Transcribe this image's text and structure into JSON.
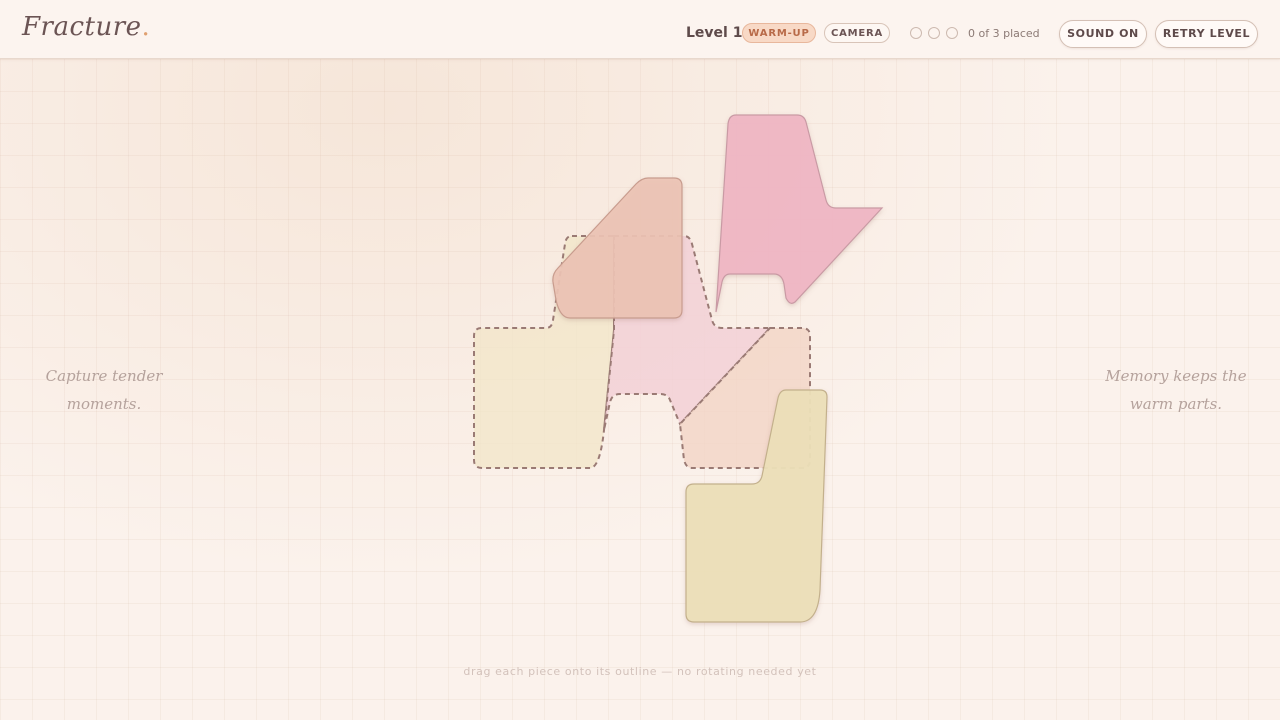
{
  "header": {
    "logo": "Fracture",
    "logo_dot": ".",
    "level": "Level 1",
    "mode_badge": "WARM-UP",
    "camera_label": "CAMERA",
    "progress": {
      "placed": 0,
      "total": 3
    },
    "progress_text": "0 of 3 placed",
    "sound_button": "SOUND ON",
    "retry_button": "RETRY LEVEL"
  },
  "quotes": {
    "left_line1": "Capture tender",
    "left_line2": "moments.",
    "right_line1": "Memory keeps the",
    "right_line2": "warm parts."
  },
  "hint": "drag each piece onto its outline — no rotating needed yet",
  "colors": {
    "outline_stroke": "#9a7a74",
    "piece_cream": "#ecdfb8",
    "piece_pink": "#efb6c4",
    "piece_peach": "#ecc3b4",
    "accent": "#e0a070"
  },
  "pieces": [
    {
      "name": "cream-piece",
      "color": "#ecdfb8"
    },
    {
      "name": "pink-piece",
      "color": "#efb6c4"
    },
    {
      "name": "peach-piece",
      "color": "#ecc3b4"
    }
  ]
}
